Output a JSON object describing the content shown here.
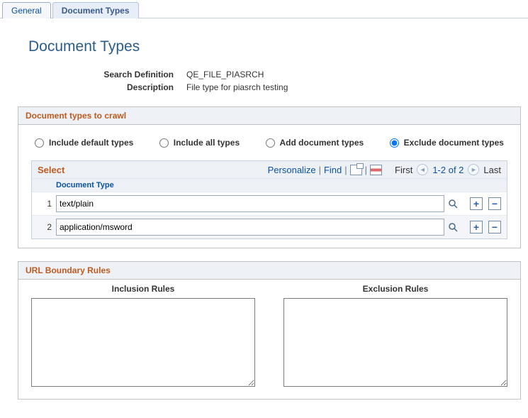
{
  "tabs": {
    "general": "General",
    "document_types": "Document Types"
  },
  "page_title": "Document Types",
  "fields": {
    "search_def_label": "Search Definition",
    "search_def_value": "QE_FILE_PIASRCH",
    "description_label": "Description",
    "description_value": "File type for piasrch testing"
  },
  "crawl_section": {
    "title": "Document types to crawl",
    "radios": {
      "include_default": "Include default types",
      "include_all": "Include all types",
      "add_types": "Add document types",
      "exclude_types": "Exclude document types",
      "selected": "exclude_types"
    },
    "grid": {
      "title": "Select",
      "links": {
        "personalize": "Personalize",
        "find": "Find"
      },
      "nav": {
        "first": "First",
        "range": "1-2 of 2",
        "last": "Last"
      },
      "header": {
        "doc_type": "Document Type"
      },
      "rows": [
        {
          "num": "1",
          "value": "text/plain"
        },
        {
          "num": "2",
          "value": "application/msword"
        }
      ]
    }
  },
  "boundary_section": {
    "title": "URL Boundary Rules",
    "inclusion_label": "Inclusion Rules",
    "exclusion_label": "Exclusion Rules",
    "inclusion_value": "",
    "exclusion_value": ""
  }
}
